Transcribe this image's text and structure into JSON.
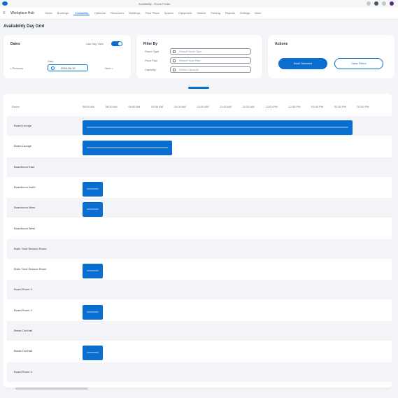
{
  "browser": {
    "address": "Availability - Room Finder",
    "tab_title": ""
  },
  "shell": {
    "app_name": "Workplace Hub",
    "tabs": [
      {
        "label": "Home",
        "active": false
      },
      {
        "label": "Bookings",
        "active": false
      },
      {
        "label": "Availability",
        "active": true
      },
      {
        "label": "Calendar",
        "active": false
      },
      {
        "label": "Resources",
        "active": false
      },
      {
        "label": "Buildings",
        "active": false
      },
      {
        "label": "Floor Plans",
        "active": false
      },
      {
        "label": "Spaces",
        "active": false
      },
      {
        "label": "Equipment",
        "active": false
      },
      {
        "label": "Visitors",
        "active": false
      },
      {
        "label": "Parking",
        "active": false
      },
      {
        "label": "Reports",
        "active": false
      },
      {
        "label": "Settings",
        "active": false
      },
      {
        "label": "More",
        "active": false
      }
    ]
  },
  "page": {
    "title": "Availability Day Grid"
  },
  "filters": {
    "date_card": {
      "title": "Dates",
      "toggle_label": "Use Day View",
      "prev_label": "< Previous",
      "date_label": "Date",
      "date_value": "2024-06-12",
      "next_label": "Next >"
    },
    "search_card": {
      "title": "Filter By",
      "fields": [
        {
          "label": "Room Type",
          "placeholder": "Select Room Type"
        },
        {
          "label": "Floor Plan",
          "placeholder": "Select Floor Plan"
        },
        {
          "label": "Capacity",
          "placeholder": "Select Capacity"
        }
      ]
    },
    "actions_card": {
      "title": "Actions",
      "primary_label": "Book Selected",
      "secondary_label": "Clear Filters"
    }
  },
  "grid": {
    "column_label": "Room",
    "time_ticks": [
      "08:00 AM",
      "08:30 AM",
      "09:00 AM",
      "09:30 AM",
      "10:00 AM",
      "10:30 AM",
      "11:00 AM",
      "11:30 AM",
      "12:00 PM",
      "12:30 PM",
      "01:00 PM",
      "01:30 PM",
      "02:00 PM"
    ],
    "rows": [
      {
        "name": "Board Lounge",
        "bookings": [
          {
            "start_slot": 0,
            "span_slots": 11.8
          }
        ]
      },
      {
        "name": "Board Lounge",
        "bookings": [
          {
            "start_slot": 0,
            "span_slots": 3.9
          }
        ]
      },
      {
        "name": "Boardroom East",
        "bookings": []
      },
      {
        "name": "Boardroom North",
        "bookings": [
          {
            "start_slot": 0,
            "span_slots": 0.9
          }
        ]
      },
      {
        "name": "Boardroom West",
        "bookings": [
          {
            "start_slot": 0,
            "span_slots": 0.9
          }
        ]
      },
      {
        "name": "Boardroom West",
        "bookings": []
      },
      {
        "name": "Brain Trust Session Room",
        "bookings": []
      },
      {
        "name": "Brain Trust Session Room",
        "bookings": [
          {
            "start_slot": 0,
            "span_slots": 0.9
          }
        ]
      },
      {
        "name": "Board Room 3",
        "bookings": []
      },
      {
        "name": "Board Room 3",
        "bookings": [
          {
            "start_slot": 0,
            "span_slots": 0.9
          }
        ]
      },
      {
        "name": "Break Out Hall",
        "bookings": []
      },
      {
        "name": "Break Out Hall",
        "bookings": [
          {
            "start_slot": 0,
            "span_slots": 0.9
          }
        ]
      },
      {
        "name": "Board Room 4",
        "bookings": []
      }
    ]
  },
  "colors": {
    "accent": "#0a6ed1",
    "row_alt": "#f2f4f8",
    "background": "#f3f5f9"
  }
}
